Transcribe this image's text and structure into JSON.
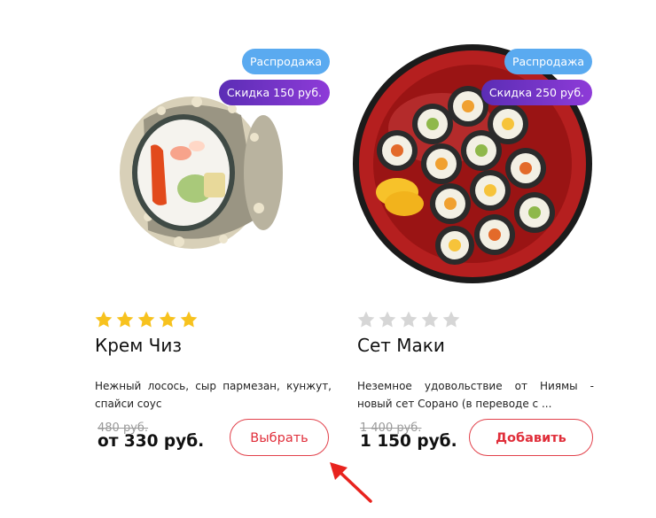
{
  "colors": {
    "accent_red": "#e02e3a",
    "sale_badge": "#5aaaf0",
    "discount_badge": "#6b33c6",
    "star_filled": "#f7c21e",
    "star_empty": "#d6d6d6"
  },
  "products": [
    {
      "badges": {
        "sale": "Распродажа",
        "discount": "Скидка 150 руб."
      },
      "rating": 5,
      "title": "Крем Чиз",
      "description": "Нежный лосось, сыр пармезан, кунжут, спайси соус",
      "old_price": "480 руб.",
      "price": "от 330 руб.",
      "button": "Выбрать",
      "image_icon": "sushi-roll-image"
    },
    {
      "badges": {
        "sale": "Распродажа",
        "discount": "Скидка 250 руб."
      },
      "rating": 0,
      "title": "Сет Маки",
      "description": "Неземное удовольствие от Ниямы - новый сет Сорано (в переводе с ...",
      "old_price": "1 400 руб.",
      "price": "1 150 руб.",
      "button": "Добавить",
      "image_icon": "maki-set-plate-image"
    }
  ]
}
